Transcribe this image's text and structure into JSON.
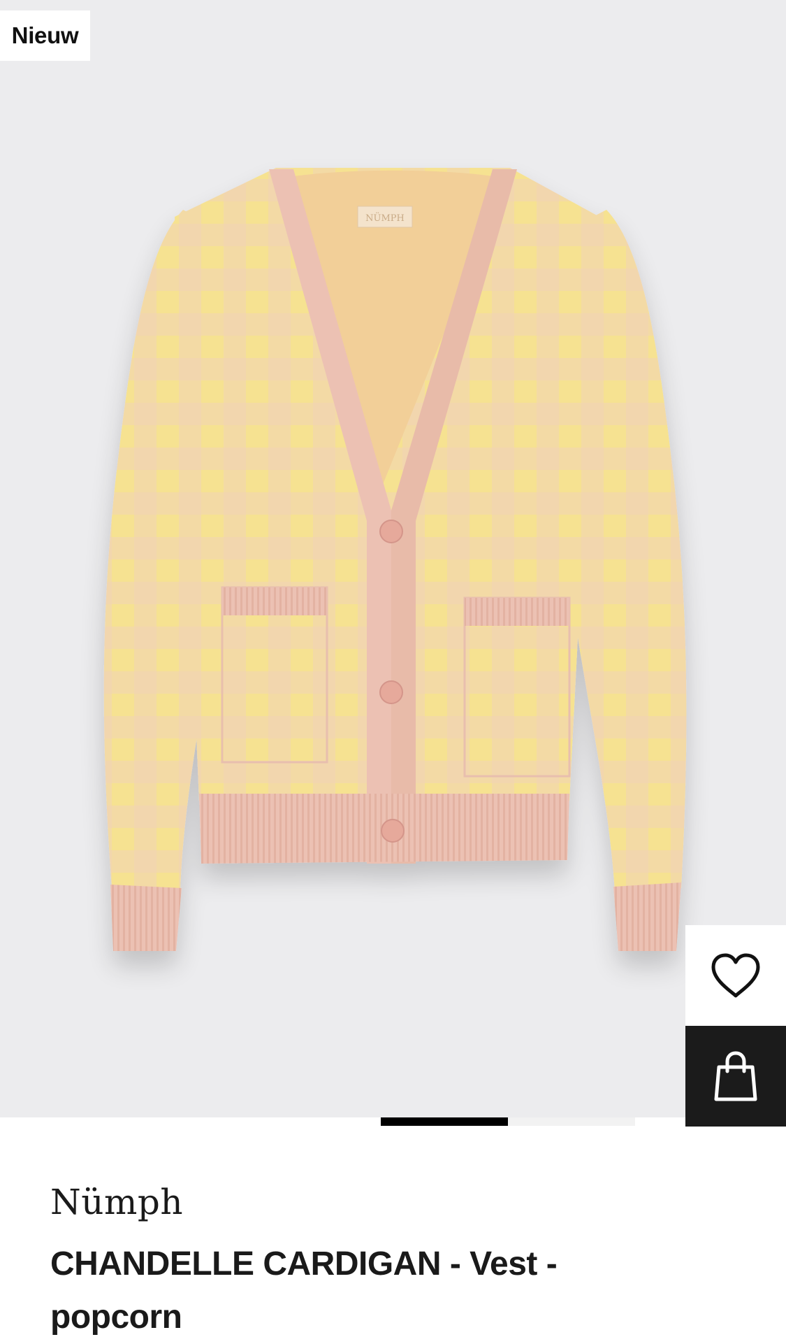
{
  "badge": {
    "label": "Nieuw"
  },
  "product": {
    "brand": "Nümph",
    "title": "CHANDELLE CARDIGAN - Vest - popcorn",
    "image_label": "NÜMPH"
  },
  "carousel": {
    "active_index": 1,
    "total": 2
  },
  "actions": {
    "wishlist_icon": "heart-icon",
    "bag_icon": "shopping-bag-icon"
  },
  "colors": {
    "background": "#ececee",
    "knit_yellow": "#f6e291",
    "knit_pink": "#eec9b7",
    "trim_pink": "#ecc1b3",
    "bag_button": "#1b1b1b"
  }
}
